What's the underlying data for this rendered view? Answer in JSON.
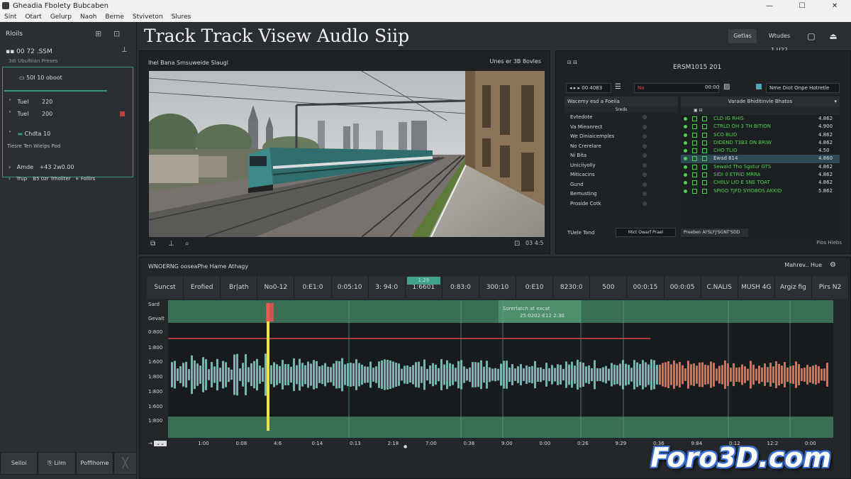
{
  "window": {
    "title": "Gheadia Fbolety Bubcaben",
    "min": "—",
    "max": "☐",
    "close": "✕"
  },
  "menu": [
    "Sint",
    "Otart",
    "Gelurp",
    "Naoh",
    "Berne",
    "Stviveton",
    "Slures"
  ],
  "sidebar": {
    "title": "Rloils",
    "item1": {
      "label": "00 72 .SSM",
      "sub": "3di Ubultiian Preses"
    },
    "item2": {
      "label": "50I 10 oboot"
    },
    "item3": {
      "label": "Tuel",
      "value": "220"
    },
    "item4": {
      "label": "Tuel",
      "value": "200"
    },
    "item5": {
      "label": "Chdta 10",
      "sub": "Tiesre Ten Wieips Pod"
    },
    "item6": {
      "label": "Amde",
      "value": "+43 2w0.00"
    },
    "item7": {
      "label": "Trup",
      "value": "B5 0zr Trholiter",
      "extra": "+ Follirs"
    },
    "bottom": [
      "Selloi",
      "Lilm",
      "Poffihome"
    ]
  },
  "header": {
    "title": "Track Track Visew Audlo Siip",
    "btn1": "Getlas",
    "btn2": "Wtudes 1.U22"
  },
  "video": {
    "title": "Ihel Bana Smsuweide Slaugl",
    "count": "Unes er 3B 8ovles",
    "time": "03 4:5"
  },
  "right": {
    "top": "ERSM1015 201",
    "field1": "00 4083",
    "field2": "No",
    "field3": "00:00",
    "field4": "Nme Diot Onpe Hotretle",
    "list_header": "Wacemy esd a Foeiia",
    "list_sub": "Sreds",
    "list": [
      "Evtedote",
      "Va Mieanrect",
      "We Diniaicemples",
      "No Crerelare",
      "Ni Bita",
      "Uniciiyolly",
      "Miticacins",
      "Gund",
      "Bemusting",
      "Proside Cotk"
    ],
    "list_footer_label": "TUele Tond",
    "list_footer_btn": "Mict Owarf Prael",
    "track_header": "Varade Bhiditinvle Bhatos",
    "tracks": [
      {
        "t": "CLD IG RHIS",
        "v": "4.862"
      },
      {
        "t": "CTRLD OH 3 TH BITION",
        "v": "4.900"
      },
      {
        "t": "SCO BLID",
        "v": "4.862"
      },
      {
        "t": "DIDEND T3B3 ON BRIW",
        "v": "4.862"
      },
      {
        "t": "CHO TLIO",
        "v": "4.50"
      },
      {
        "t": "Ewad 814",
        "v": "4.860"
      },
      {
        "t": "Sewald Tho Sgstur GTS",
        "v": "4.862"
      },
      {
        "t": "SIDI 0 ETRID MRRA",
        "v": "4.862"
      },
      {
        "t": "CH0LV LIO E SNE TOAT",
        "v": "4.862"
      },
      {
        "t": "SPIGD TJFD SYIOBOS AKKID",
        "v": "5.862"
      }
    ],
    "track_footer": "Preeben Al'SLFJ'SGNT'SDD",
    "bottom_right": "Pios Hiebs"
  },
  "timeline": {
    "title": "WNOERNG ooseaPhe Hame Athagy",
    "right": "Mahrev.. Hue",
    "cols": [
      "Suncst",
      "Erofied",
      "Br|ath",
      "No0-12",
      "0:E1:0",
      "0:05:10",
      "3: 94:0",
      "1:6601",
      "0:83:0",
      "300:10",
      "0:E10",
      "8230:0",
      "500",
      "00:0:15",
      "00:0:05",
      "C.NALIS",
      "MUSH 4G",
      "Argiz fig",
      "Pirs N2"
    ],
    "active_label": "1:29",
    "ylabels": [
      "Sard",
      "Gevalt",
      "0:800",
      "1:800",
      "1:600",
      "1:800",
      "1:800",
      "1:600",
      "1:800"
    ],
    "xlabels": [
      "1:00",
      "0:08",
      "4:6",
      "0:14",
      "0:13",
      "2:18",
      "7:00",
      "0:38",
      "9:00",
      "0:00",
      "0:26",
      "9:29",
      "0:36",
      "9:84",
      "0:12",
      "12:2",
      "0:00"
    ],
    "clip_label": "Sorerlatch at excat\n25:0202-E12 2:30"
  },
  "watermark": "Foro3D.com"
}
